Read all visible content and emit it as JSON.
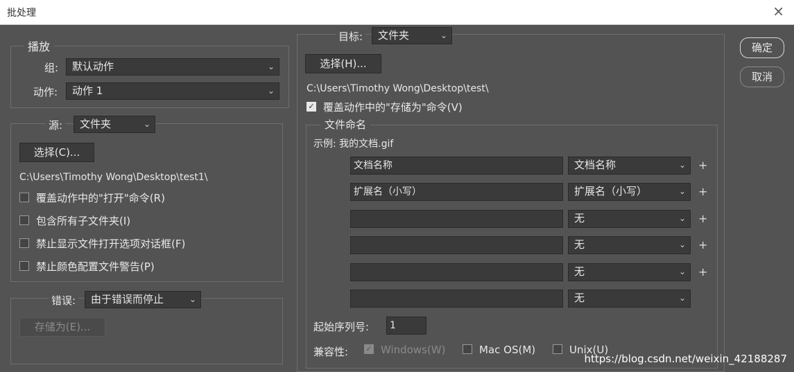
{
  "window": {
    "title": "批处理",
    "close_glyph": "×"
  },
  "play": {
    "legend": "播放",
    "group_label": "组:",
    "group_value": "默认动作",
    "action_label": "动作:",
    "action_value": "动作 1"
  },
  "source": {
    "label": "源:",
    "value": "文件夹",
    "choose_label": "选择(C)...",
    "path": "C:\\Users\\Timothy Wong\\Desktop\\test1\\",
    "options": [
      {
        "label": "覆盖动作中的\"打开\"命令(R)",
        "checked": false
      },
      {
        "label": "包含所有子文件夹(I)",
        "checked": false
      },
      {
        "label": "禁止显示文件打开选项对话框(F)",
        "checked": false
      },
      {
        "label": "禁止颜色配置文件警告(P)",
        "checked": false
      }
    ]
  },
  "errors": {
    "label": "错误:",
    "value": "由于错误而停止",
    "save_as_label": "存储为(E)..."
  },
  "target": {
    "label": "目标:",
    "value": "文件夹",
    "choose_label": "选择(H)...",
    "path": "C:\\Users\\Timothy Wong\\Desktop\\test\\",
    "override_save_label": "覆盖动作中的\"存储为\"命令(V)",
    "override_save_checked": true
  },
  "naming": {
    "legend": "文件命名",
    "example": "示例: 我的文档.gif",
    "rows": [
      {
        "text": "文档名称",
        "select": "文档名称"
      },
      {
        "text": "扩展名（小写）",
        "select": "扩展名（小写）"
      },
      {
        "text": "",
        "select": "无"
      },
      {
        "text": "",
        "select": "无"
      },
      {
        "text": "",
        "select": "无"
      },
      {
        "text": "",
        "select": "无"
      }
    ],
    "plus_glyph": "+",
    "start_serial_label": "起始序列号:",
    "start_serial_value": "1",
    "compat_label": "兼容性:",
    "compat": [
      {
        "label": "Windows(W)",
        "checked": true,
        "disabled": true
      },
      {
        "label": "Mac OS(M)",
        "checked": false,
        "disabled": false
      },
      {
        "label": "Unix(U)",
        "checked": false,
        "disabled": false
      }
    ]
  },
  "buttons": {
    "ok": "确定",
    "cancel": "取消"
  },
  "chevron_glyph": "⌄",
  "watermark": "https://blog.csdn.net/weixin_42188287"
}
